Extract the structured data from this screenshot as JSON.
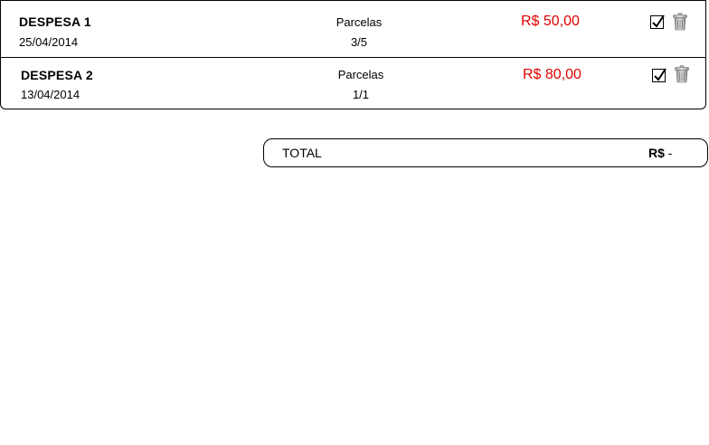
{
  "expenses": [
    {
      "title": "DESPESA 1",
      "date": "25/04/2014",
      "installments_label": "Parcelas",
      "installments_value": "3/5",
      "amount": "R$ 50,00",
      "checked": true
    },
    {
      "title": "DESPESA 2",
      "date": "13/04/2014",
      "installments_label": "Parcelas",
      "installments_value": "1/1",
      "amount": "R$ 80,00",
      "checked": true
    }
  ],
  "total": {
    "label": "TOTAL",
    "currency": "R$",
    "value": "-"
  },
  "icons": {
    "checkbox": "checkbox-checked-icon",
    "delete": "trash-icon"
  },
  "colors": {
    "amount": "#e00000"
  }
}
